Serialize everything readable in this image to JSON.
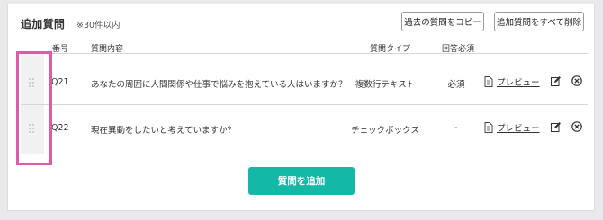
{
  "section": {
    "title": "追加質問",
    "note": "※30件以内"
  },
  "toolbar": {
    "copy_label": "過去の質問をコピー",
    "delete_all_label": "追加質問をすべて削除"
  },
  "table": {
    "headers": {
      "number": "番号",
      "content": "質問内容",
      "type": "質問タイプ",
      "required": "回答必須"
    },
    "rows": [
      {
        "number": "Q21",
        "content": "あなたの周囲に人間関係や仕事で悩みを抱えている人はいますか？",
        "type": "複数行テキスト",
        "required": "必須",
        "preview_label": "プレビュー"
      },
      {
        "number": "Q22",
        "content": "現在異動をしたいと考えていますか？",
        "type": "チェックボックス",
        "required": "-",
        "preview_label": "プレビュー"
      }
    ]
  },
  "add_button": {
    "label": "質問を追加"
  },
  "colors": {
    "accent": "#13b8a6",
    "highlight": "#e05aa5"
  },
  "icons": [
    "drag-handle-icon",
    "document-icon",
    "edit-icon",
    "delete-icon"
  ]
}
